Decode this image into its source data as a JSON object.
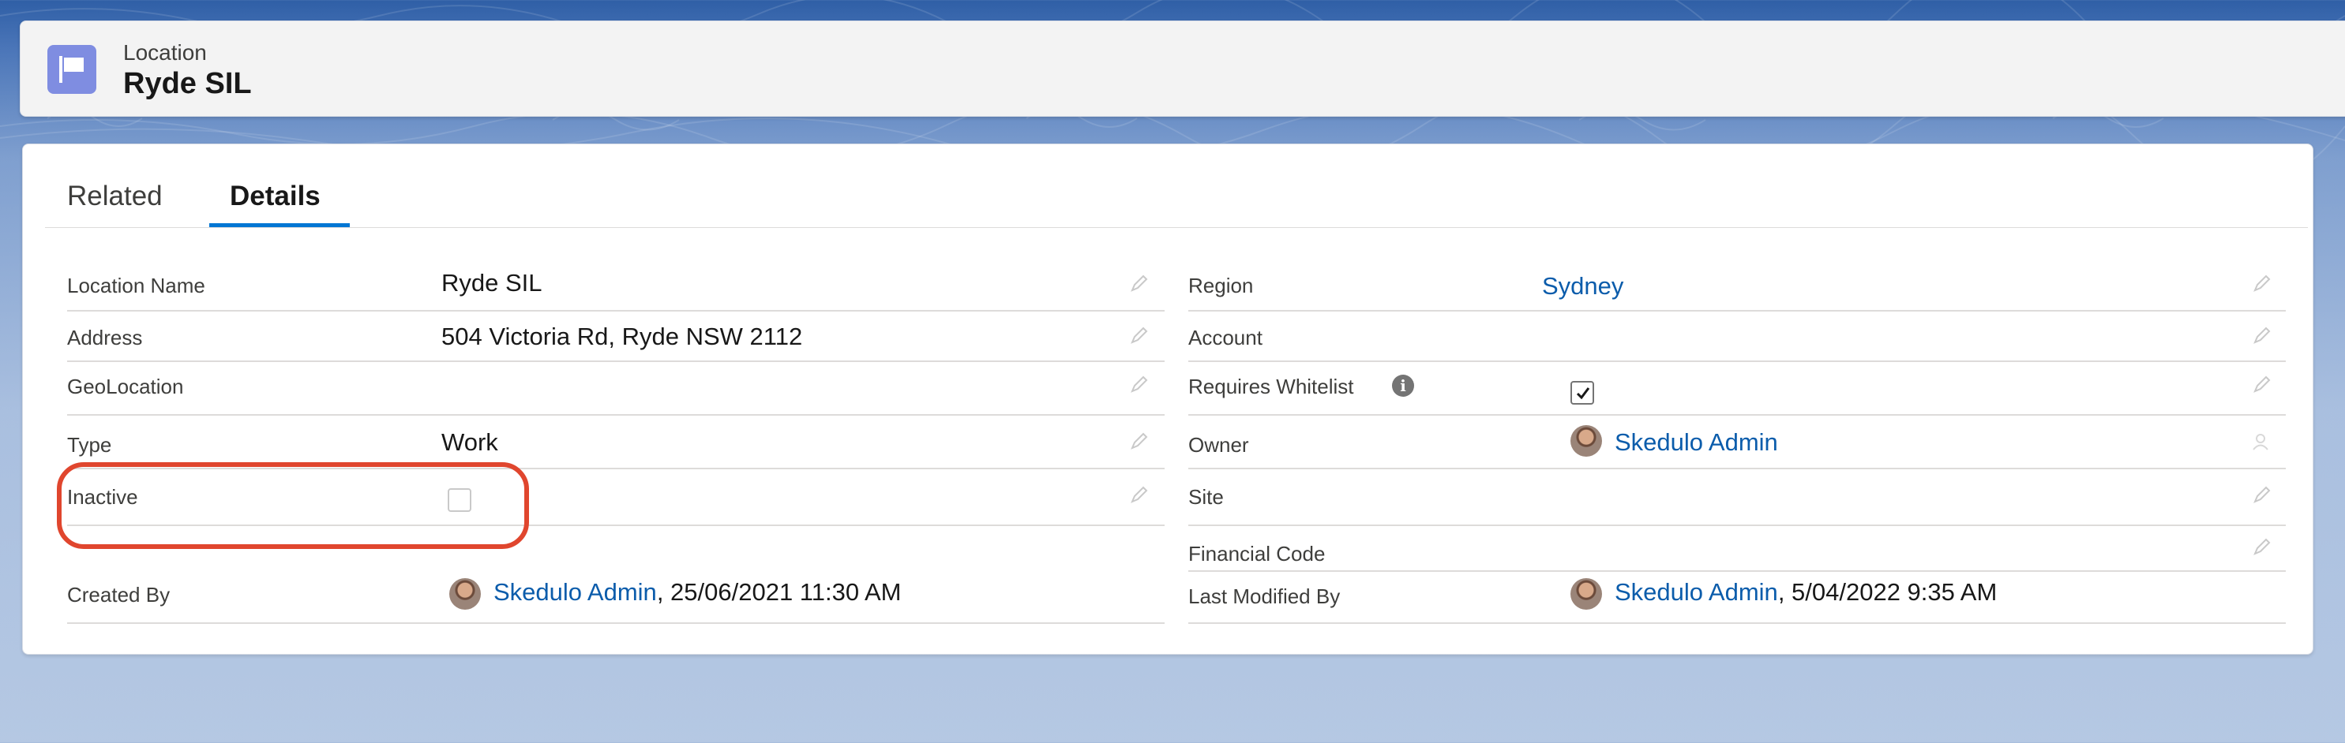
{
  "colors": {
    "accent": "#0176d3",
    "link": "#0b5cab",
    "highlight": "#e0462e",
    "record_icon": "#7f8de1"
  },
  "header": {
    "object_label": "Location",
    "record_title": "Ryde SIL",
    "icon": "flag-icon"
  },
  "tabs": [
    {
      "label": "Related",
      "active": false
    },
    {
      "label": "Details",
      "active": true
    }
  ],
  "left_fields": {
    "location_name": {
      "label": "Location Name",
      "value": "Ryde SIL"
    },
    "address": {
      "label": "Address",
      "value": "504 Victoria Rd, Ryde NSW 2112"
    },
    "geolocation": {
      "label": "GeoLocation",
      "value": ""
    },
    "type": {
      "label": "Type",
      "value": "Work"
    },
    "inactive": {
      "label": "Inactive",
      "checked": false
    },
    "created_by": {
      "label": "Created By",
      "user": "Skedulo Admin",
      "date": ", 25/06/2021 11:30 AM"
    }
  },
  "right_fields": {
    "region": {
      "label": "Region",
      "value": "Sydney"
    },
    "account": {
      "label": "Account",
      "value": ""
    },
    "requires_whitelist": {
      "label": "Requires Whitelist",
      "checked": true,
      "info_icon": "info-icon"
    },
    "owner": {
      "label": "Owner",
      "user": "Skedulo Admin"
    },
    "site": {
      "label": "Site",
      "value": ""
    },
    "financial_code": {
      "label": "Financial Code",
      "value": ""
    },
    "last_modified_by": {
      "label": "Last Modified By",
      "user": "Skedulo Admin",
      "date": ", 5/04/2022 9:35 AM"
    }
  }
}
